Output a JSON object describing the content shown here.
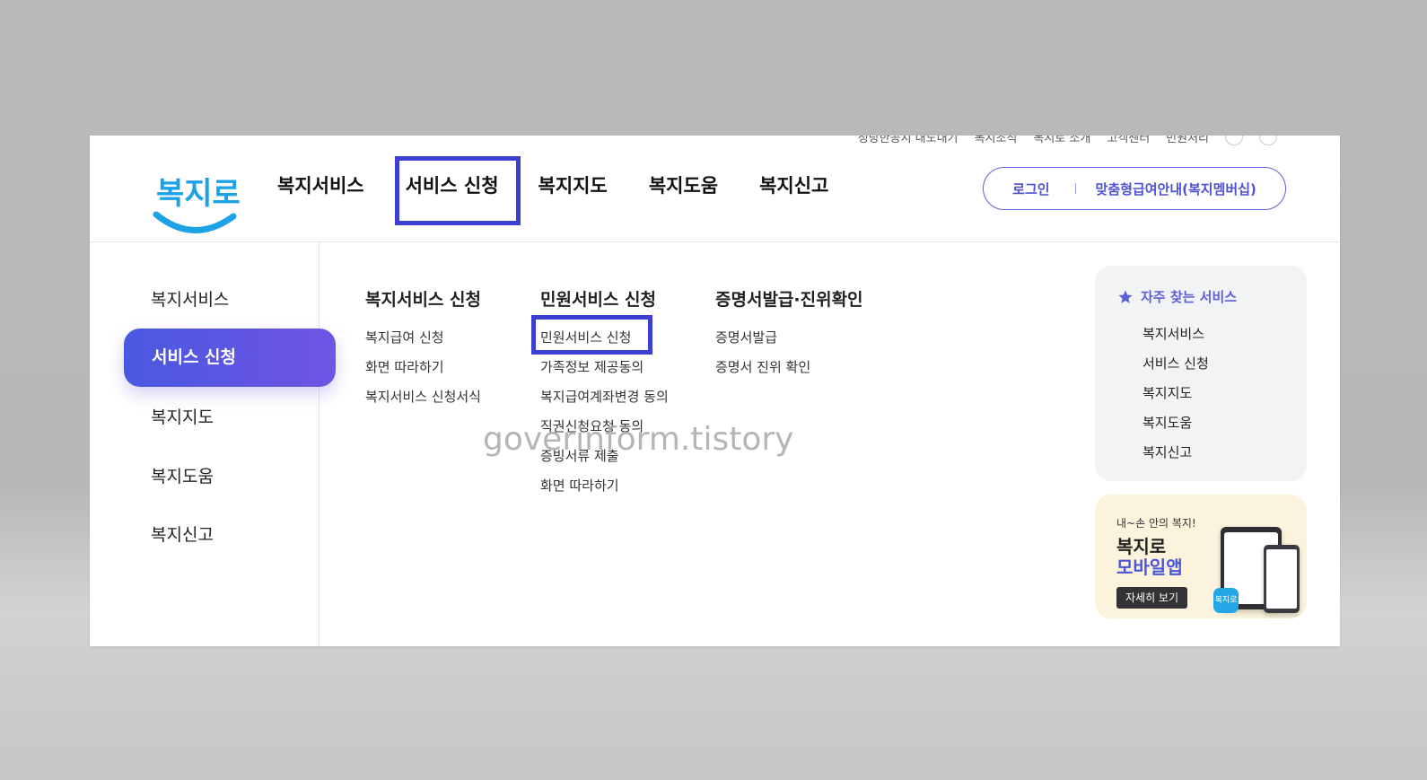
{
  "utility_bar": {
    "items": [
      "정당한공지 내도내기",
      "복지조직",
      "복지로 소개",
      "고객센터",
      "민원처리"
    ]
  },
  "logo": {
    "text": "복지로"
  },
  "gnb": {
    "items": [
      "복지서비스",
      "서비스 신청",
      "복지지도",
      "복지도움",
      "복지신고"
    ]
  },
  "auth": {
    "login": "로그인",
    "membership": "맞춤형급여안내(복지멤버십)"
  },
  "sidebar": {
    "items": [
      "복지서비스",
      "서비스 신청",
      "복지지도",
      "복지도움",
      "복지신고"
    ]
  },
  "submenu": {
    "columns": [
      {
        "title": "복지서비스 신청",
        "links": [
          "복지급여 신청",
          "화면 따라하기",
          "복지서비스 신청서식"
        ]
      },
      {
        "title": "민원서비스 신청",
        "links": [
          "민원서비스 신청",
          "가족정보 제공동의",
          "복지급여계좌변경 동의",
          "직권신청요청 동의",
          "증빙서류 제출",
          "화면 따라하기"
        ]
      },
      {
        "title": "증명서발급·진위확인",
        "links": [
          "증명서발급",
          "증명서 진위 확인"
        ]
      }
    ]
  },
  "watermark": "goverinform.tistory",
  "favorites": {
    "title": "자주 찾는 서비스",
    "items": [
      "복지서비스",
      "서비스 신청",
      "복지지도",
      "복지도움",
      "복지신고"
    ]
  },
  "app_banner": {
    "tagline": "내~손 안의 복지!",
    "title_line1": "복지로",
    "title_line2": "모바일앱",
    "button": "자세히 보기",
    "icon_text": "복지로"
  },
  "colors": {
    "accent": "#4e52d1",
    "highlight_border": "#3d3fd0",
    "active_gradient_start": "#4a58e0",
    "active_gradient_end": "#6f55e3",
    "logo_blue": "#1ea2e6"
  }
}
